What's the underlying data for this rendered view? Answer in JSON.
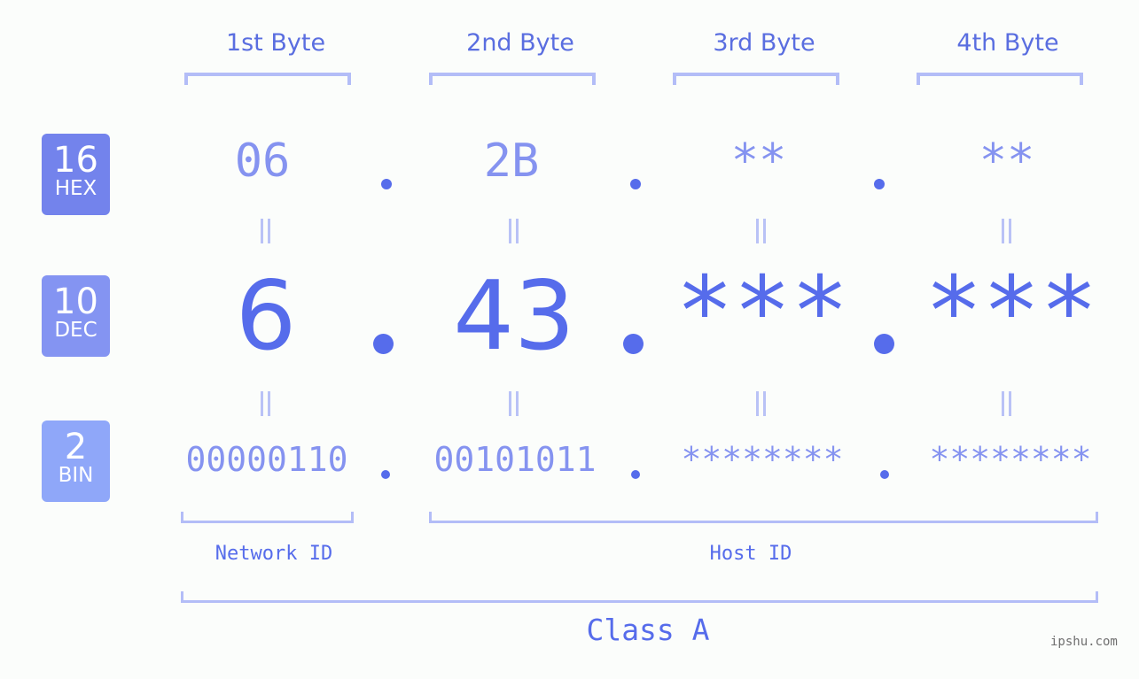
{
  "bytes": [
    {
      "label": "1st Byte",
      "hex": "06",
      "dec": "6",
      "bin": "00000110"
    },
    {
      "label": "2nd Byte",
      "hex": "2B",
      "dec": "43",
      "bin": "00101011"
    },
    {
      "label": "3rd Byte",
      "hex": "**",
      "dec": "***",
      "bin": "********"
    },
    {
      "label": "4th Byte",
      "hex": "**",
      "dec": "***",
      "bin": "********"
    }
  ],
  "badges": {
    "hex": {
      "num": "16",
      "name": "HEX",
      "color": "#7383ec"
    },
    "dec": {
      "num": "10",
      "name": "DEC",
      "color": "#8494f2"
    },
    "bin": {
      "num": "2",
      "name": "BIN",
      "color": "#8fa7f9"
    }
  },
  "network_id_label": "Network ID",
  "host_id_label": "Host ID",
  "class_label": "Class A",
  "watermark": "ipshu.com",
  "colors": {
    "primary": "#566ceb",
    "light": "#8593f0",
    "bracket": "#b3bdf7"
  }
}
